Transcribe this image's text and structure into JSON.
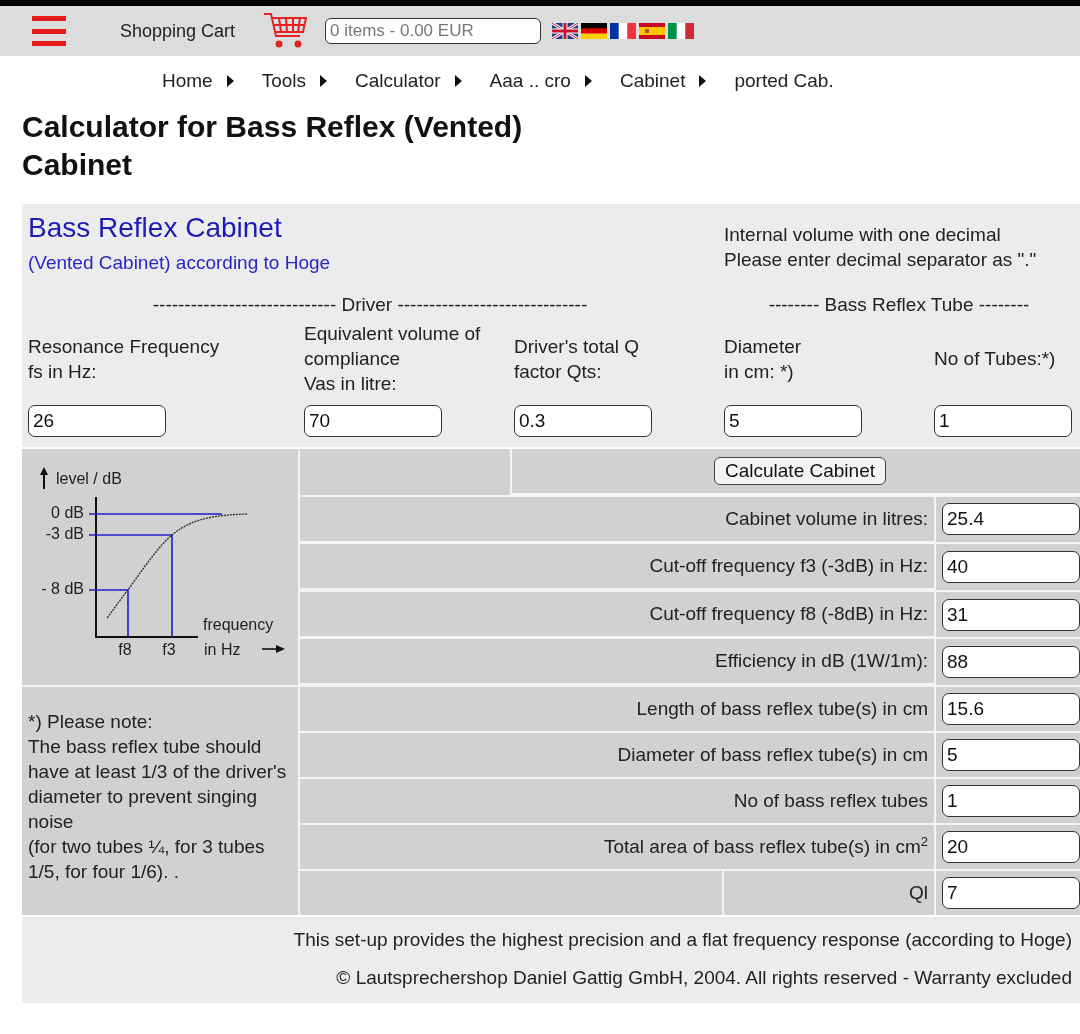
{
  "header": {
    "cart_label": "Shopping Cart",
    "cart_summary": {
      "placeholder": "0 items - 0.00 EUR"
    }
  },
  "breadcrumbs": [
    "Home",
    "Tools",
    "Calculator",
    "Aaa .. cro",
    "Cabinet",
    "ported Cab."
  ],
  "page_title": "Calculator for Bass Reflex (Vented) Cabinet",
  "calculator": {
    "title": "Bass Reflex Cabinet",
    "subtitle": "(Vented Cabinet) according to Hoge",
    "hints": [
      "Internal volume with one decimal",
      "Please enter decimal separator as \".\""
    ],
    "group_headers": [
      "----------------------------- Driver ------------------------------",
      "-------- Bass Reflex Tube --------"
    ],
    "inputs": [
      {
        "label": [
          "Resonance Frequency",
          "fs in Hz:"
        ],
        "value": "26"
      },
      {
        "label": [
          "Equivalent volume of",
          "compliance",
          "Vas in litre:"
        ],
        "value": "70"
      },
      {
        "label": [
          "Driver's total Q",
          "factor Qts:"
        ],
        "value": "0.3"
      },
      {
        "label": [
          "Diameter",
          "in cm: *)"
        ],
        "value": "5"
      },
      {
        "label": [
          "No of Tubes:*)"
        ],
        "value": "1"
      }
    ],
    "button": "Calculate Cabinet",
    "diagram": {
      "y_axis": "level / dB",
      "levels": [
        "0 dB",
        "-3 dB",
        "- 8 dB"
      ],
      "points": [
        "f8",
        "f3"
      ],
      "x_axis": [
        "frequency",
        "in Hz"
      ]
    },
    "results": [
      {
        "label": "Cabinet volume in litres:",
        "value": "25.4"
      },
      {
        "label": "Cut-off frequency f3 (-3dB) in Hz:",
        "value": "40"
      },
      {
        "label": "Cut-off frequency f8 (-8dB) in Hz:",
        "value": "31"
      },
      {
        "label": "Efficiency in dB (1W/1m):",
        "value": "88"
      },
      {
        "label": "Length of bass reflex tube(s) in cm",
        "value": "15.6"
      },
      {
        "label": "Diameter of bass reflex tube(s) in cm",
        "value": "5"
      },
      {
        "label": "No of bass reflex tubes",
        "value": "1"
      },
      {
        "label": "Total area of bass reflex tube(s) in cm$^{2}$",
        "value": "20"
      },
      {
        "label": "Ql",
        "value": "7"
      }
    ],
    "note": [
      "*) Please note:",
      "The bass reflex tube should have at least 1/3 of the driver's diameter to prevent singing noise",
      "(for two tubes ¼, for 3 tubes 1/5, for four 1/6). ."
    ],
    "footer": [
      "This set-up provides the highest precision and a flat frequency response (according to Hoge)",
      "© Lautsprechershop Daniel Gattig GmbH, 2004. All rights reserved - Warranty excluded"
    ]
  }
}
